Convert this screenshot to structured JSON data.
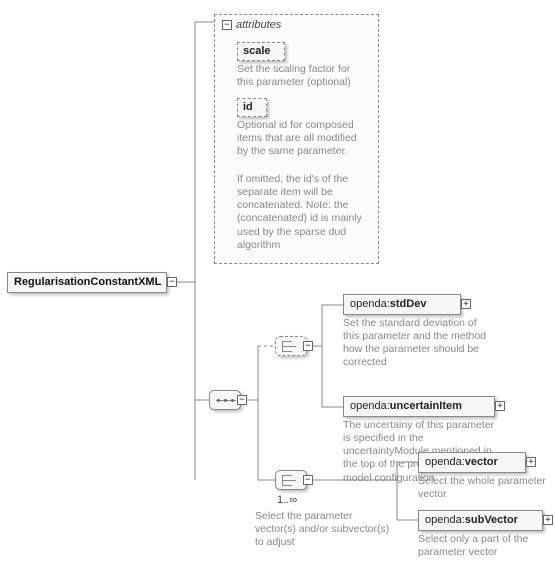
{
  "root": {
    "label": "RegularisationConstantXML"
  },
  "attrPanel": {
    "header": "attributes",
    "attrs": {
      "scale": {
        "label": "scale",
        "desc": "Set the scaling factor for this parameter (optional)"
      },
      "id": {
        "label": "id",
        "desc1": "Optional id for composed items that are all modified by the same parameter.",
        "desc2": "If omitted, the id's of the separate item will be concatenated. Note: the (concatenated) id is mainly used by the sparse dud algorithm"
      }
    }
  },
  "stdDev": {
    "prefix": "openda:",
    "name": "stdDev",
    "desc": "Set the standard deviation of this parameter and the method how the parameter should be corrected"
  },
  "uncertainItem": {
    "prefix": "openda:",
    "name": "uncertainItem",
    "desc": "The uncertainy of this parameter is specified in the uncertaintyModule mentioned in the top of the present stochastic model configuration"
  },
  "vector": {
    "prefix": "openda:",
    "name": "vector",
    "desc": "Select the whole parameter vector"
  },
  "subVector": {
    "prefix": "openda:",
    "name": "subVector",
    "desc": "Select only a part of the parameter vector"
  },
  "multiplicity": {
    "label": "1..∞",
    "desc": "Select the parameter vector(s) and/or subvector(s) to adjust"
  },
  "icons": {
    "minus": "−",
    "plus": "+"
  }
}
